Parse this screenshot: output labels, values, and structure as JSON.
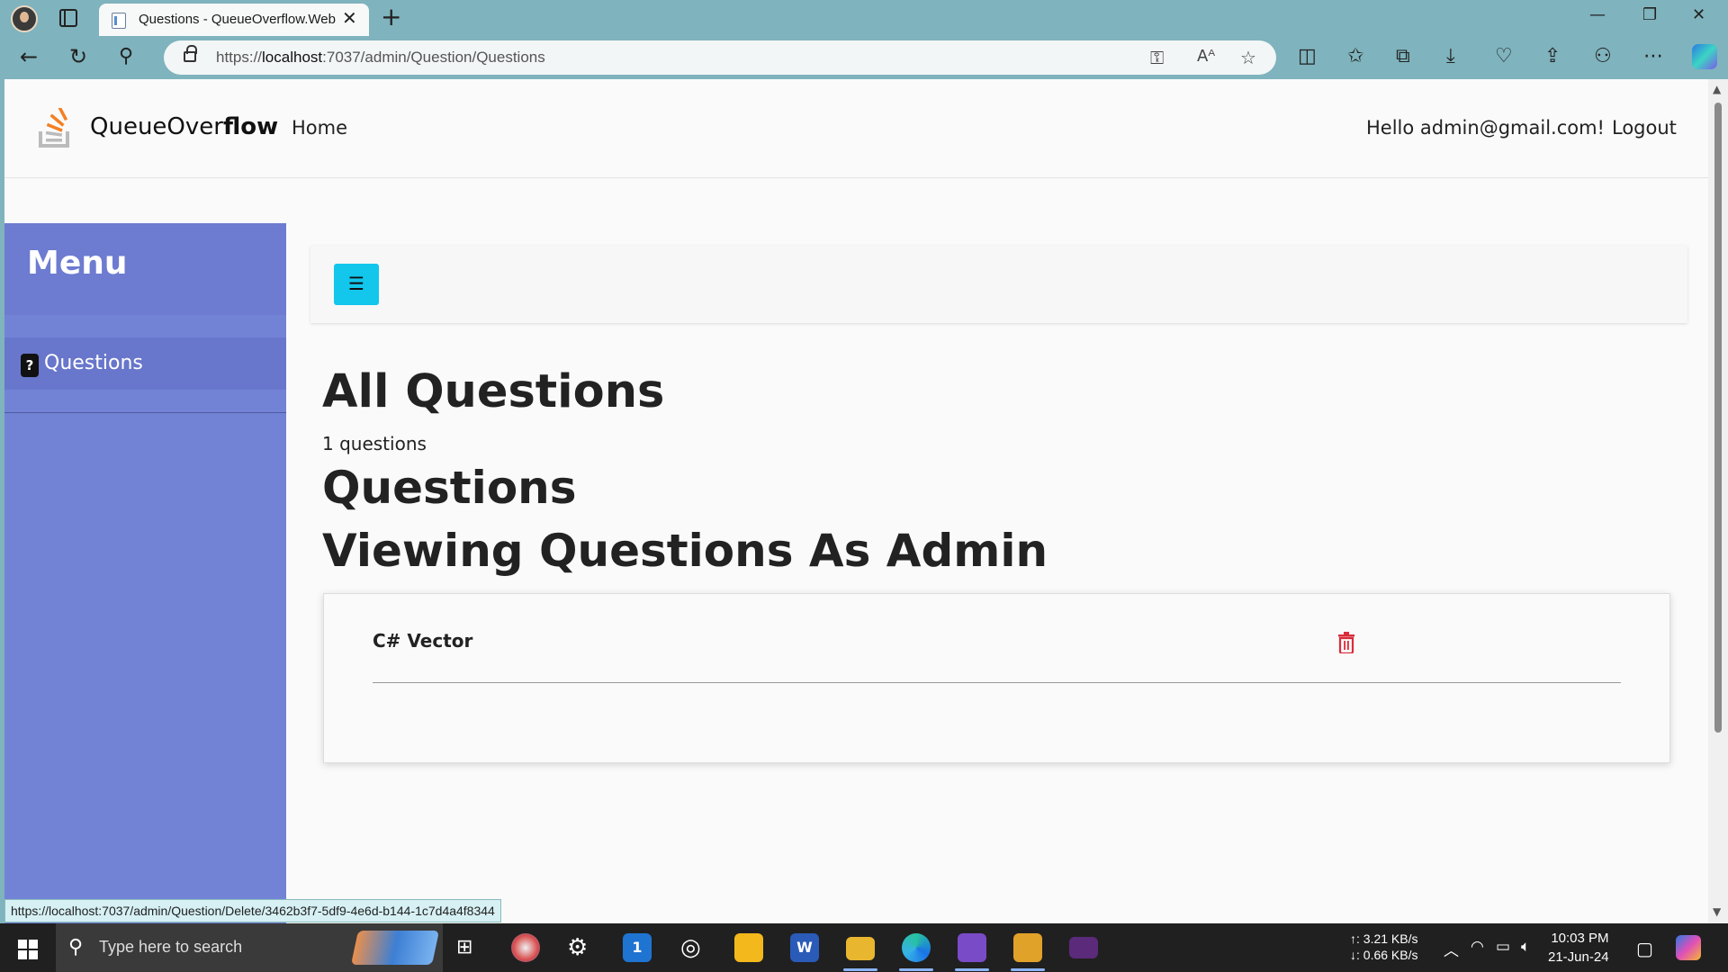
{
  "browser": {
    "tab_title": "Questions - QueueOverflow.Web",
    "url_prefix": "https://",
    "url_host": "localhost",
    "url_path": ":7037/admin/Question/Questions",
    "status_url": "https://localhost:7037/admin/Question/Delete/3462b3f7-5df9-4e6d-b144-1c7d4a4f8344"
  },
  "site": {
    "brand_regular": "QueueOver",
    "brand_bold": "flow",
    "nav_home": "Home",
    "greeting": "Hello admin@gmail.com!",
    "logout": "Logout"
  },
  "sidebar": {
    "title": "Menu",
    "items": [
      {
        "label": "Questions",
        "icon": "question-icon"
      }
    ]
  },
  "main": {
    "toggle_glyph": "☰",
    "heading": "All Questions",
    "count_text": "1 questions",
    "section_title": "Questions",
    "subtitle": "Viewing Questions As Admin",
    "questions": [
      {
        "title": "C# Vector"
      }
    ]
  },
  "taskbar": {
    "search_placeholder": "Type here to search",
    "net_up": "↑: 3.21 KB/s",
    "net_down": "↓: 0.66 KB/s",
    "time": "10:03 PM",
    "date": "21-Jun-24"
  },
  "colors": {
    "sidebar": "#7283d6",
    "toggle_button": "#12c6ec",
    "delete_icon": "#d92c3a"
  }
}
